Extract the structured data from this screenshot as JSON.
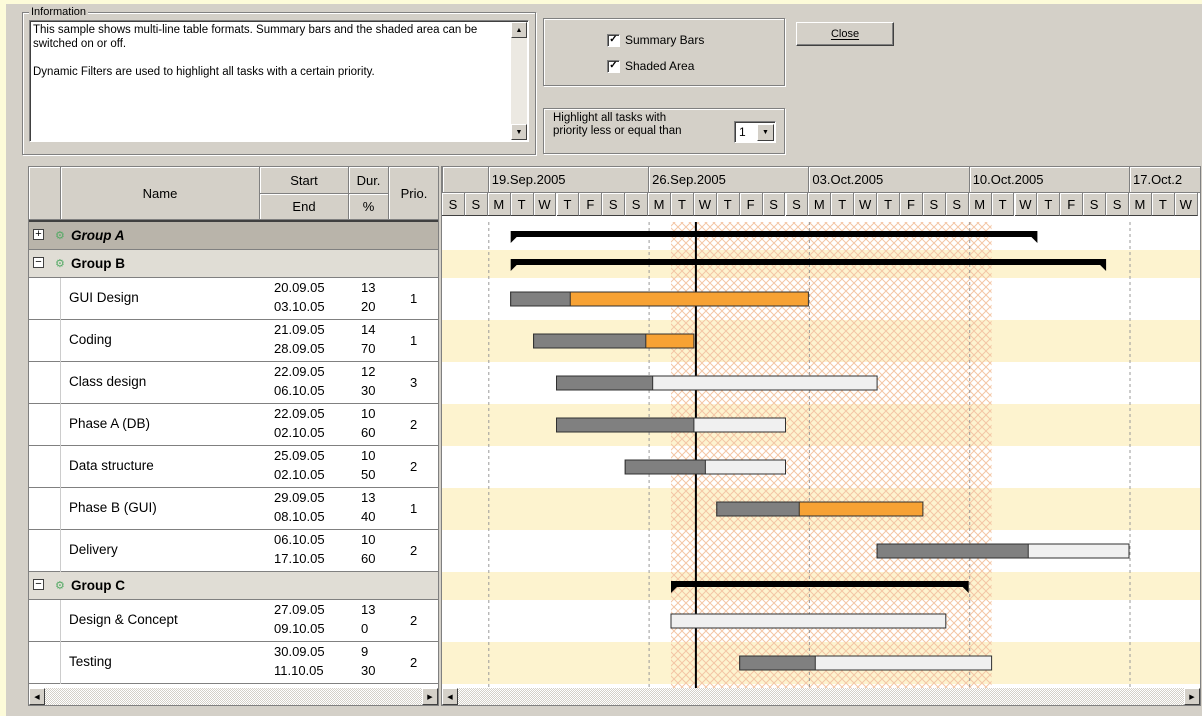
{
  "info": {
    "legend": "Information",
    "text1": "This sample shows multi-line table formats. Summary bars and the shaded area can be switched on or off.",
    "text2": "Dynamic Filters are used to highlight all tasks with a certain priority."
  },
  "options": {
    "summary_bars_label": "Summary Bars",
    "summary_bars_checked": true,
    "shaded_area_label": "Shaded Area",
    "shaded_area_checked": true
  },
  "close_label": "Close",
  "filter": {
    "label_line1": "Highlight all tasks with",
    "label_line2": "priority less or equal than",
    "value": "1"
  },
  "table": {
    "headers": {
      "name": "Name",
      "start": "Start",
      "end": "End",
      "dur": "Dur.",
      "pct": "%",
      "prio": "Prio."
    },
    "rows": [
      {
        "type": "group",
        "name": "Group A",
        "expanded": false
      },
      {
        "type": "group",
        "name": "Group B",
        "expanded": true
      },
      {
        "type": "task",
        "name": "GUI Design",
        "start": "20.09.05",
        "end": "03.10.05",
        "dur": "13",
        "pct": "20",
        "prio": "1"
      },
      {
        "type": "task",
        "name": "Coding",
        "start": "21.09.05",
        "end": "28.09.05",
        "dur": "14",
        "pct": "70",
        "prio": "1"
      },
      {
        "type": "task",
        "name": "Class design",
        "start": "22.09.05",
        "end": "06.10.05",
        "dur": "12",
        "pct": "30",
        "prio": "3"
      },
      {
        "type": "task",
        "name": "Phase A (DB)",
        "start": "22.09.05",
        "end": "02.10.05",
        "dur": "10",
        "pct": "60",
        "prio": "2"
      },
      {
        "type": "task",
        "name": "Data structure",
        "start": "25.09.05",
        "end": "02.10.05",
        "dur": "10",
        "pct": "50",
        "prio": "2"
      },
      {
        "type": "task",
        "name": "Phase B (GUI)",
        "start": "29.09.05",
        "end": "08.10.05",
        "dur": "13",
        "pct": "40",
        "prio": "1"
      },
      {
        "type": "task",
        "name": "Delivery",
        "start": "06.10.05",
        "end": "17.10.05",
        "dur": "10",
        "pct": "60",
        "prio": "2"
      },
      {
        "type": "group",
        "name": "Group C",
        "expanded": true
      },
      {
        "type": "task",
        "name": "Design & Concept",
        "start": "27.09.05",
        "end": "09.10.05",
        "dur": "13",
        "pct": "0",
        "prio": "2"
      },
      {
        "type": "task",
        "name": "Testing",
        "start": "30.09.05",
        "end": "11.10.05",
        "dur": "9",
        "pct": "30",
        "prio": "2"
      }
    ]
  },
  "gantt": {
    "weeks": [
      "19.Sep.2005",
      "26.Sep.2005",
      "03.Oct.2005",
      "10.Oct.2005",
      "17.Oct.2"
    ],
    "days": [
      "S",
      "S",
      "M",
      "T",
      "W",
      "T",
      "F",
      "S",
      "S",
      "M",
      "T",
      "W",
      "T",
      "F",
      "S",
      "S",
      "M",
      "T",
      "W",
      "T",
      "F",
      "S",
      "S",
      "M",
      "T",
      "W",
      "T",
      "F",
      "S",
      "S",
      "M",
      "T",
      "W"
    ],
    "highlight_color": "#f7a234",
    "progress_color": "#808080",
    "rest_color": "#f0f0f0",
    "stripe_color": "#fdf3cf",
    "shade_color": "#f4c6a5"
  }
}
